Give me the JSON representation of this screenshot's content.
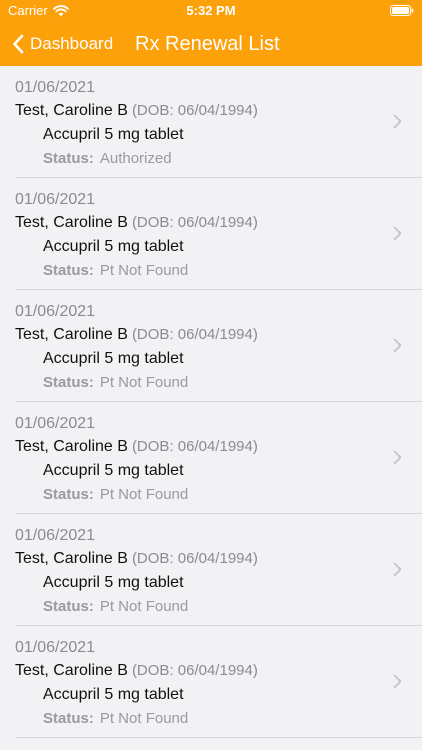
{
  "status_bar": {
    "carrier": "Carrier",
    "time": "5:32 PM"
  },
  "nav": {
    "back_label": "Dashboard",
    "title": "Rx Renewal List"
  },
  "theme": {
    "accent": "#fda10b"
  },
  "list": {
    "status_label": "Status:",
    "items": [
      {
        "date": "01/06/2021",
        "name": "Test, Caroline B",
        "dob": "(DOB: 06/04/1994)",
        "medication": "Accupril 5 mg tablet",
        "status": "Authorized"
      },
      {
        "date": "01/06/2021",
        "name": "Test, Caroline B",
        "dob": "(DOB: 06/04/1994)",
        "medication": "Accupril 5 mg tablet",
        "status": "Pt Not Found"
      },
      {
        "date": "01/06/2021",
        "name": "Test, Caroline B",
        "dob": "(DOB: 06/04/1994)",
        "medication": "Accupril 5 mg tablet",
        "status": "Pt Not Found"
      },
      {
        "date": "01/06/2021",
        "name": "Test, Caroline B",
        "dob": "(DOB: 06/04/1994)",
        "medication": "Accupril 5 mg tablet",
        "status": "Pt Not Found"
      },
      {
        "date": "01/06/2021",
        "name": "Test, Caroline B",
        "dob": "(DOB: 06/04/1994)",
        "medication": "Accupril 5 mg tablet",
        "status": "Pt Not Found"
      },
      {
        "date": "01/06/2021",
        "name": "Test, Caroline B",
        "dob": "(DOB: 06/04/1994)",
        "medication": "Accupril 5 mg tablet",
        "status": "Pt Not Found"
      }
    ]
  }
}
